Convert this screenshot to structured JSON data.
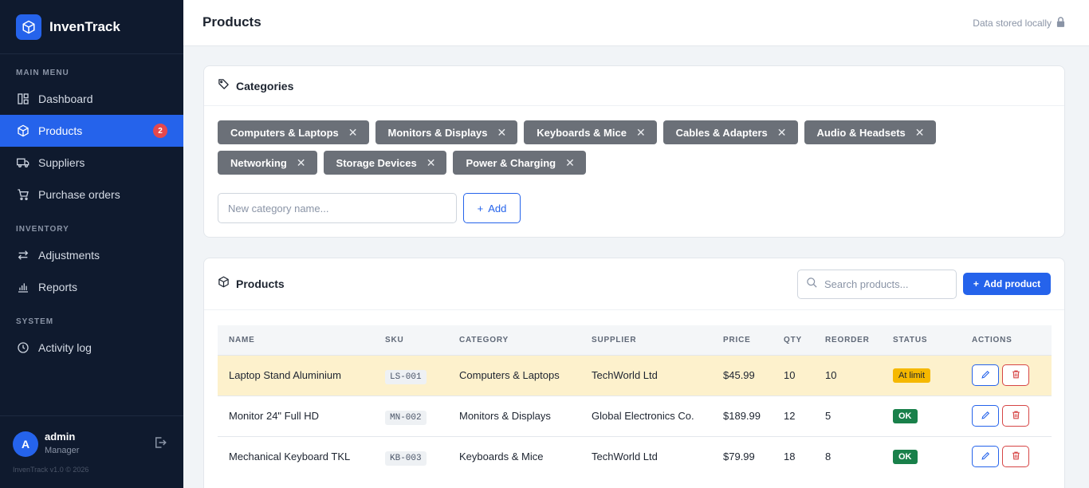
{
  "app": {
    "name": "InvenTrack",
    "version": "InvenTrack v1.0 © 2026"
  },
  "sidebar": {
    "sections": [
      {
        "label": "MAIN MENU",
        "items": [
          {
            "label": "Dashboard",
            "icon": "dashboard-icon"
          },
          {
            "label": "Products",
            "icon": "box-icon",
            "active": true,
            "badge": "2"
          },
          {
            "label": "Suppliers",
            "icon": "truck-icon"
          },
          {
            "label": "Purchase orders",
            "icon": "cart-icon"
          }
        ]
      },
      {
        "label": "INVENTORY",
        "items": [
          {
            "label": "Adjustments",
            "icon": "arrows-icon"
          },
          {
            "label": "Reports",
            "icon": "bar-chart-icon"
          }
        ]
      },
      {
        "label": "SYSTEM",
        "items": [
          {
            "label": "Activity log",
            "icon": "clock-icon"
          }
        ]
      }
    ],
    "user": {
      "initial": "A",
      "name": "admin",
      "role": "Manager"
    }
  },
  "header": {
    "title": "Products",
    "storage_note": "Data stored locally"
  },
  "categories": {
    "title": "Categories",
    "chips": [
      "Computers & Laptops",
      "Monitors & Displays",
      "Keyboards & Mice",
      "Cables & Adapters",
      "Audio & Headsets",
      "Networking",
      "Storage Devices",
      "Power & Charging"
    ],
    "input_placeholder": "New category name...",
    "add_label": "Add"
  },
  "products": {
    "title": "Products",
    "search_placeholder": "Search products...",
    "add_label": "Add product",
    "columns": [
      "NAME",
      "SKU",
      "CATEGORY",
      "SUPPLIER",
      "PRICE",
      "QTY",
      "REORDER",
      "STATUS",
      "ACTIONS"
    ],
    "rows": [
      {
        "name": "Laptop Stand Aluminium",
        "sku": "LS-001",
        "category": "Computers & Laptops",
        "supplier": "TechWorld Ltd",
        "price": "$45.99",
        "qty": "10",
        "reorder": "10",
        "status": "At limit",
        "status_type": "limit"
      },
      {
        "name": "Monitor 24\" Full HD",
        "sku": "MN-002",
        "category": "Monitors & Displays",
        "supplier": "Global Electronics Co.",
        "price": "$189.99",
        "qty": "12",
        "reorder": "5",
        "status": "OK",
        "status_type": "ok"
      },
      {
        "name": "Mechanical Keyboard TKL",
        "sku": "KB-003",
        "category": "Keyboards & Mice",
        "supplier": "TechWorld Ltd",
        "price": "$79.99",
        "qty": "18",
        "reorder": "8",
        "status": "OK",
        "status_type": "ok"
      }
    ]
  },
  "colors": {
    "sidebar_bg": "#0f1a2e",
    "accent": "#2563eb",
    "warn_row": "#fdf1cc",
    "ok": "#19804a",
    "limit": "#f5b800",
    "danger": "#d64545"
  }
}
